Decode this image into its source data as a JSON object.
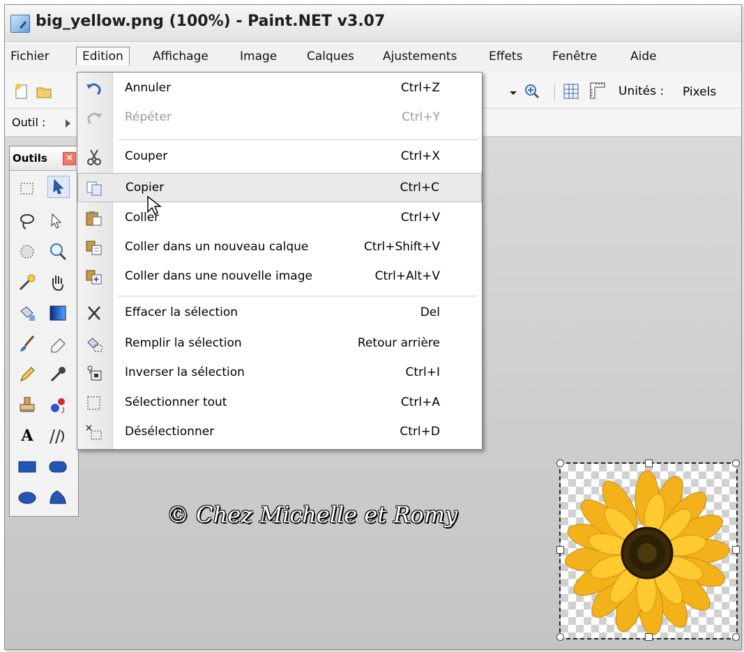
{
  "window": {
    "title": "big_yellow.png (100%) - Paint.NET v3.07"
  },
  "menubar": {
    "items": [
      "Fichier",
      "Edition",
      "Affichage",
      "Image",
      "Calques",
      "Ajustements",
      "Effets",
      "Fenêtre",
      "Aide"
    ],
    "active": "Edition"
  },
  "toolbar": {
    "units_label": "Unités :",
    "units_value": "Pixels"
  },
  "toolbar2": {
    "tool_label": "Outil :"
  },
  "tools_panel": {
    "title": "Outils",
    "close_glyph": "×",
    "text_tool_glyph": "A"
  },
  "edit_menu": {
    "items": [
      {
        "label": "Annuler",
        "shortcut": "Ctrl+Z",
        "icon": "undo-icon",
        "enabled": true
      },
      {
        "label": "Répéter",
        "shortcut": "Ctrl+Y",
        "icon": "redo-icon",
        "enabled": false
      },
      {
        "label": "Couper",
        "shortcut": "Ctrl+X",
        "icon": "scissors-icon",
        "enabled": true
      },
      {
        "label": "Copier",
        "shortcut": "Ctrl+C",
        "icon": "copy-icon",
        "enabled": true,
        "highlighted": true
      },
      {
        "label": "Coller",
        "shortcut": "Ctrl+V",
        "icon": "paste-icon",
        "enabled": true
      },
      {
        "label": "Coller dans un nouveau calque",
        "shortcut": "Ctrl+Shift+V",
        "icon": "paste-new-layer-icon",
        "enabled": true
      },
      {
        "label": "Coller dans une nouvelle image",
        "shortcut": "Ctrl+Alt+V",
        "icon": "paste-new-image-icon",
        "enabled": true
      },
      {
        "label": "Effacer la sélection",
        "shortcut": "Del",
        "icon": "erase-selection-icon",
        "enabled": true
      },
      {
        "label": "Remplir la sélection",
        "shortcut": "Retour arrière",
        "icon": "fill-selection-icon",
        "enabled": true
      },
      {
        "label": "Inverser la sélection",
        "shortcut": "Ctrl+I",
        "icon": "invert-selection-icon",
        "enabled": true
      },
      {
        "label": "Sélectionner tout",
        "shortcut": "Ctrl+A",
        "icon": "select-all-icon",
        "enabled": true
      },
      {
        "label": "Désélectionner",
        "shortcut": "Ctrl+D",
        "icon": "deselect-icon",
        "enabled": true
      }
    ]
  },
  "canvas": {
    "watermark": "© Chez Michelle et Romy"
  }
}
